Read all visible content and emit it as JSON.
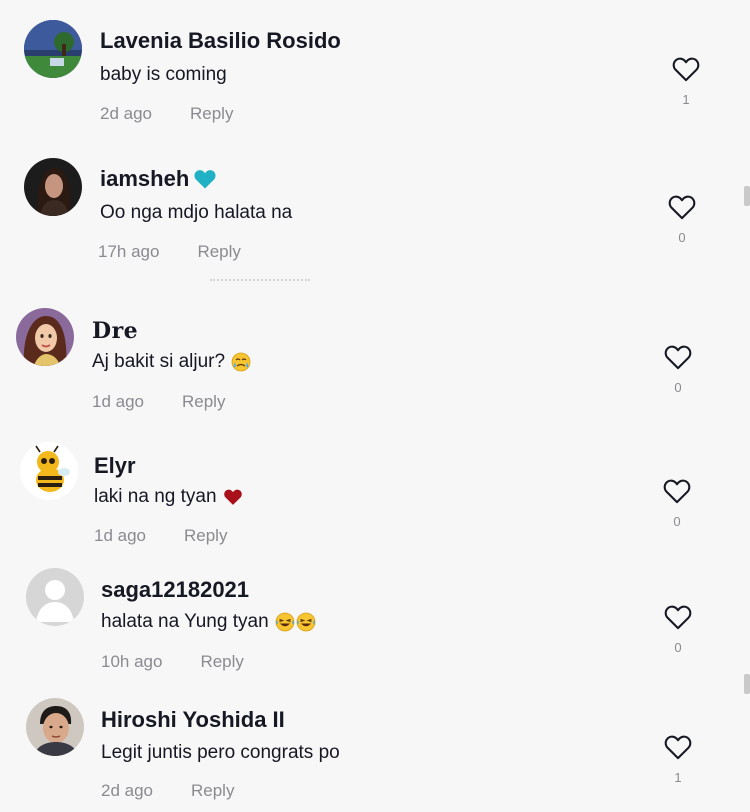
{
  "comments": [
    {
      "username": "Lavenia Basilio Rosido",
      "text": "baby is coming",
      "time": "2d ago",
      "reply_label": "Reply",
      "likes": "1",
      "avatar": "landscape-avatar"
    },
    {
      "username": "iamsheh",
      "text": "Oo nga mdjo halata na",
      "time": "17h ago",
      "reply_label": "Reply",
      "likes": "0",
      "avatar": "woman-photo-avatar",
      "name_icon": "teal-heart-icon"
    },
    {
      "username": "Dre",
      "text": "Aj bakit si aljur?",
      "time": "1d ago",
      "reply_label": "Reply",
      "likes": "0",
      "avatar": "princess-avatar",
      "text_icon": "crying-face-emoji"
    },
    {
      "username": "Elyr",
      "text": "laki na ng tyan",
      "time": "1d ago",
      "reply_label": "Reply",
      "likes": "0",
      "avatar": "bee-avatar",
      "text_icon": "red-heart-emoji"
    },
    {
      "username": "saga12182021",
      "text": "halata na Yung tyan",
      "time": "10h ago",
      "reply_label": "Reply",
      "likes": "0",
      "avatar": "default-avatar",
      "text_icon": "laughing-tears-emoji"
    },
    {
      "username": "Hiroshi Yoshida II",
      "text": "Legit juntis pero congrats po",
      "time": "2d ago",
      "reply_label": "Reply",
      "likes": "1",
      "avatar": "man-photo-avatar"
    }
  ],
  "colors": {
    "background": "#f7f7f7",
    "text": "#161823",
    "muted": "#8a8b91",
    "teal_heart": "#20b2c4",
    "red_heart": "#a8101a"
  }
}
